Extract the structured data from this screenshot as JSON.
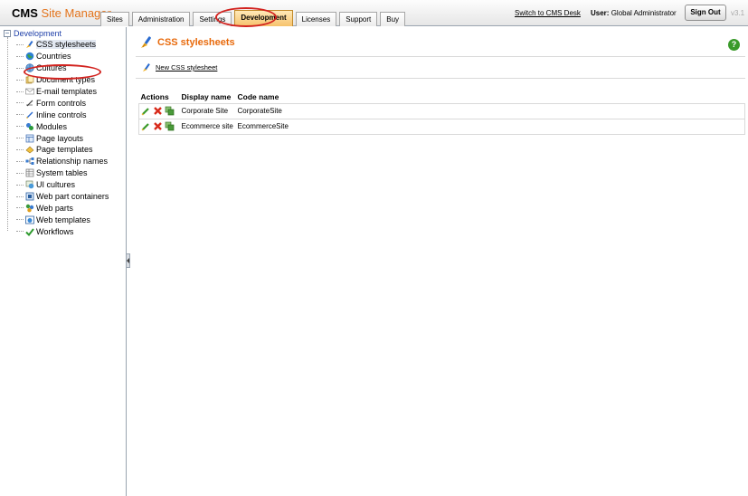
{
  "header": {
    "logo_cms": "CMS",
    "logo_product": "Site Manager",
    "tabs": [
      {
        "label": "Sites"
      },
      {
        "label": "Administration"
      },
      {
        "label": "Settings"
      },
      {
        "label": "Development",
        "active": true
      },
      {
        "label": "Licenses"
      },
      {
        "label": "Support"
      },
      {
        "label": "Buy"
      }
    ],
    "switch_link": "Switch to CMS Desk",
    "user_label": "User:",
    "user_name": "Global Administrator",
    "signout_label": "Sign Out",
    "version": "v3.1"
  },
  "tree": {
    "root_label": "Development",
    "root_expander": "−",
    "items": [
      {
        "label": "CSS stylesheets",
        "icon": "css-stylesheets-icon",
        "selected": true
      },
      {
        "label": "Countries",
        "icon": "globe-icon"
      },
      {
        "label": "Cultures",
        "icon": "cultures-globe-icon"
      },
      {
        "label": "Document types",
        "icon": "document-types-icon"
      },
      {
        "label": "E-mail templates",
        "icon": "email-templates-icon"
      },
      {
        "label": "Form controls",
        "icon": "form-controls-icon"
      },
      {
        "label": "Inline controls",
        "icon": "inline-controls-icon"
      },
      {
        "label": "Modules",
        "icon": "modules-icon"
      },
      {
        "label": "Page layouts",
        "icon": "page-layouts-icon"
      },
      {
        "label": "Page templates",
        "icon": "page-templates-icon"
      },
      {
        "label": "Relationship names",
        "icon": "relationship-names-icon"
      },
      {
        "label": "System tables",
        "icon": "system-tables-icon"
      },
      {
        "label": "UI cultures",
        "icon": "ui-cultures-icon"
      },
      {
        "label": "Web part containers",
        "icon": "web-part-containers-icon"
      },
      {
        "label": "Web parts",
        "icon": "web-parts-icon"
      },
      {
        "label": "Web templates",
        "icon": "web-templates-icon"
      },
      {
        "label": "Workflows",
        "icon": "workflows-icon"
      }
    ]
  },
  "main": {
    "title": "CSS stylesheets",
    "help_glyph": "?",
    "new_link": "New CSS stylesheet",
    "grid": {
      "columns": [
        "Actions",
        "Display name",
        "Code name"
      ],
      "rows": [
        {
          "display_name": "Corporate Site",
          "code_name": "CorporateSite"
        },
        {
          "display_name": "Ecommerce site",
          "code_name": "EcommerceSite"
        }
      ]
    }
  },
  "colors": {
    "accent_orange": "#e86a0c",
    "tree_root_blue": "#1e3fa8",
    "highlight_red": "#d2231f",
    "help_green": "#3a9a2a"
  }
}
